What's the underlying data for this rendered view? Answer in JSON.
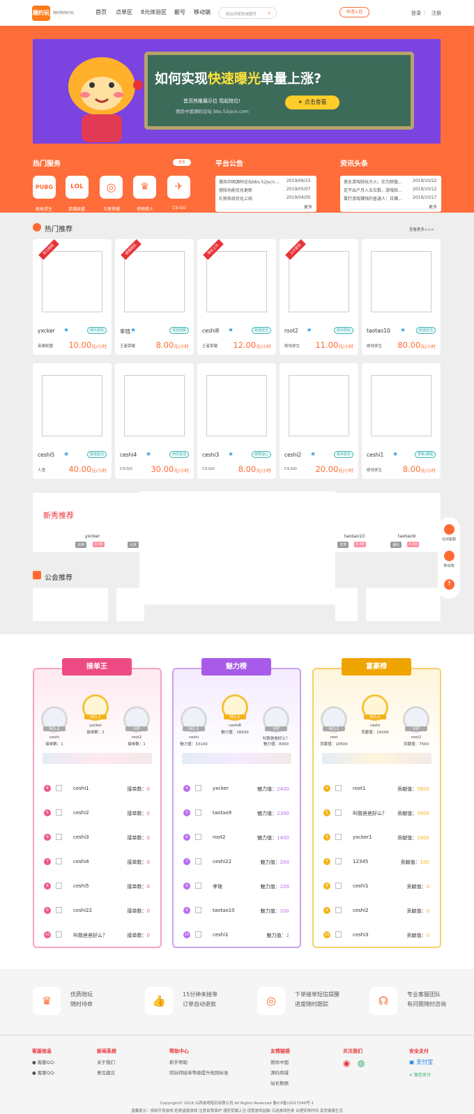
{
  "header": {
    "logo": "趣约玩",
    "slogan": "随时随地约玩",
    "nav": [
      "首页",
      "点单区",
      "8元体验区",
      "靓号",
      "移动端"
    ],
    "search_placeholder": "陪玩师昵称或靓号",
    "apply": "申请入驻",
    "login": "登录",
    "register": "注册"
  },
  "banner": {
    "title_a": "如何实现",
    "title_b": "快速曝光",
    "title_c": "单量上涨?",
    "sub": "首页热推展示位 现起抢位!",
    "sub2": "德尚中国源码论坛 bbs.52jscn.com",
    "btn": "点击查看"
  },
  "services": {
    "title": "热门服务",
    "more": "更多",
    "items": [
      {
        "icon": "PUBG",
        "label": "绝地求生"
      },
      {
        "icon": "LOL",
        "label": "英雄联盟"
      },
      {
        "icon": "◎",
        "label": "王者荣耀"
      },
      {
        "icon": "♛",
        "label": "怪物猎人"
      },
      {
        "icon": "✈",
        "label": "CS:GO"
      }
    ]
  },
  "notice": {
    "title": "平台公告",
    "rows": [
      {
        "t": "德尚中国源码论坛bbs.52jscn....",
        "d": "2019/06/15"
      },
      {
        "t": "搭陪功能优化更新",
        "d": "2019/05/07"
      },
      {
        "t": "礼物系统优化上线",
        "d": "2019/04/05"
      }
    ],
    "more": "更多"
  },
  "news": {
    "title": "资讯头条",
    "rows": [
      {
        "t": "美女游戏陪玩大火，实力颜值...",
        "d": "2019/10/22"
      },
      {
        "t": "足不出户月入五位数，游戏陪...",
        "d": "2019/10/12"
      },
      {
        "t": "靠打游戏赚钱的普通人：日赚...",
        "d": "2019/10/17"
      }
    ],
    "more": "更多"
  },
  "hot": {
    "title": "热门推荐",
    "more": "查看更多>>>",
    "cards": [
      {
        "rib": "实力陪练",
        "name": "yxcker",
        "tag": "娱乐陪玩",
        "game": "英雄联盟",
        "price": "10.00",
        "unit": "元/小时"
      },
      {
        "rib": "颜值陪玩",
        "name": "李琉",
        "tag": "语音陪聊",
        "game": "王者荣耀",
        "price": "8.00",
        "unit": "元/小时"
      },
      {
        "rib": "带你上分",
        "name": "ceshi8",
        "tag": "颜值担当",
        "game": "王者荣耀",
        "price": "12.00",
        "unit": "元/小时"
      },
      {
        "rib": "上分首选",
        "name": "root2",
        "tag": "技术陪玩",
        "game": "绝地求生",
        "price": "11.00",
        "unit": "元/小时"
      },
      {
        "rib": "",
        "name": "taotao10",
        "tag": "颜值担当",
        "game": "绝地求生",
        "price": "80.00",
        "unit": "元/小时"
      },
      {
        "rib": "",
        "name": "ceshi5",
        "tag": "颜值担当",
        "game": "人渣",
        "price": "40.00",
        "unit": "元/小时"
      },
      {
        "rib": "",
        "name": "ceshi4",
        "tag": "声优担当",
        "game": "CS:GO",
        "price": "30.00",
        "unit": "元/小时"
      },
      {
        "rib": "",
        "name": "ceshi3",
        "tag": "搞笑担心",
        "game": "CS:GO",
        "price": "8.00",
        "unit": "元/小时"
      },
      {
        "rib": "",
        "name": "ceshi2",
        "tag": "技术能手",
        "game": "CS:GO",
        "price": "20.00",
        "unit": "元/小时"
      },
      {
        "rib": "",
        "name": "ceshi1",
        "tag": "萝莉,御姐",
        "game": "绝地求生",
        "price": "8.00",
        "unit": "元/小时"
      }
    ]
  },
  "newcomer": {
    "title": "新秀推荐",
    "items": [
      {
        "name": "yxcker",
        "city": "云西",
        "age": "0.49"
      },
      {
        "name": "taotao10",
        "city": "甘肃",
        "age": "0.48"
      },
      {
        "name": "taotao9",
        "city": "湖北",
        "age": "0.49"
      }
    ],
    "city2": "北京"
  },
  "guild": {
    "title": "公会推荐"
  },
  "float": {
    "service": "在线客服",
    "mobile": "移动端"
  },
  "ranks": [
    {
      "title": "接单王",
      "top": [
        {
          "n": "ceshi",
          "v": "接单数：1",
          "b": "NO.2"
        },
        {
          "n": "yxcker",
          "v": "接单数：2",
          "b": "NO.1"
        },
        {
          "n": "root2",
          "v": "接单数：1",
          "b": "VIP"
        }
      ],
      "rows": [
        {
          "r": "4",
          "n": "ceshi1",
          "v": "接单数：",
          "x": "0"
        },
        {
          "r": "5",
          "n": "ceshi2",
          "v": "接单数：",
          "x": "0"
        },
        {
          "r": "6",
          "n": "ceshi3",
          "v": "接单数：",
          "x": "0"
        },
        {
          "r": "7",
          "n": "ceshi4",
          "v": "接单数：",
          "x": "0"
        },
        {
          "r": "8",
          "n": "ceshi5",
          "v": "接单数：",
          "x": "0"
        },
        {
          "r": "9",
          "n": "ceshi22",
          "v": "接单数：",
          "x": "0"
        },
        {
          "r": "10",
          "n": "叫我爸爸好么？",
          "v": "接单数：",
          "x": "0"
        }
      ]
    },
    {
      "title": "魅力榜",
      "top": [
        {
          "n": "ceshi",
          "v": "魅力值：33100",
          "b": "NO.2"
        },
        {
          "n": "ceshi8",
          "v": "魅力值：18200",
          "b": "NO.1"
        },
        {
          "n": "叫我爸爸好么？",
          "v": "魅力值：8000",
          "b": "VIP"
        }
      ],
      "rows": [
        {
          "r": "4",
          "n": "yxcker",
          "v": "魅力值：",
          "x": "2400"
        },
        {
          "r": "5",
          "n": "taotao9",
          "v": "魅力值：",
          "x": "2300"
        },
        {
          "r": "6",
          "n": "root2",
          "v": "魅力值：",
          "x": "1400"
        },
        {
          "r": "7",
          "n": "ceshi22",
          "v": "魅力值：",
          "x": "200"
        },
        {
          "r": "8",
          "n": "李琉",
          "v": "魅力值：",
          "x": "200"
        },
        {
          "r": "9",
          "n": "taotao10",
          "v": "魅力值：",
          "x": "100"
        },
        {
          "r": "10",
          "n": "ceshi1",
          "v": "魅力值：",
          "x": "2"
        }
      ]
    },
    {
      "title": "富豪榜",
      "top": [
        {
          "n": "root",
          "v": "贡献值：10500",
          "b": "NO.2"
        },
        {
          "n": "ceshi",
          "v": "贡献值：19100",
          "b": "NO.1"
        },
        {
          "n": "root2",
          "v": "贡献值：7500",
          "b": "VIP"
        }
      ],
      "rows": [
        {
          "r": "4",
          "n": "root1",
          "v": "贡献值：",
          "x": "5600"
        },
        {
          "r": "5",
          "n": "叫我爸爸好么？",
          "v": "贡献值：",
          "x": "3900"
        },
        {
          "r": "6",
          "n": "yxcker1",
          "v": "贡献值：",
          "x": "1800"
        },
        {
          "r": "7",
          "n": "12345",
          "v": "贡献值：",
          "x": "100"
        },
        {
          "r": "8",
          "n": "ceshi1",
          "v": "贡献值：",
          "x": "0"
        },
        {
          "r": "9",
          "n": "ceshi2",
          "v": "贡献值：",
          "x": "0"
        },
        {
          "r": "10",
          "n": "ceshi3",
          "v": "贡献值：",
          "x": "0"
        }
      ]
    }
  ],
  "features": [
    {
      "l1": "优质陪玩",
      "l2": "随时待命"
    },
    {
      "l1": "15分钟未接单",
      "l2": "订单自动退款"
    },
    {
      "l1": "下单接单短信提醒",
      "l2": "进度随时跟踪"
    },
    {
      "l1": "专业客服团队",
      "l2": "有问题随时咨询"
    }
  ],
  "footer": {
    "cols": [
      {
        "h": "客服信息",
        "items": [
          "客服QQ:",
          "客服QQ:"
        ]
      },
      {
        "h": "新闻系统",
        "items": [
          "关于我们",
          "意见建议"
        ]
      },
      {
        "h": "帮助中心",
        "items": [
          "新手帮助",
          "陪玩师接单等级提升规则标准"
        ]
      },
      {
        "h": "友情链接",
        "items": [
          "德尚中国",
          "源码商城",
          "站长数据"
        ]
      },
      {
        "h": "关注我们",
        "items": []
      },
      {
        "h": "安全支付",
        "items": [
          "支付宝",
          "微信支付"
        ]
      }
    ],
    "copyright": "Copyright© 2018 山西游戏陪玩有限公司 All Rights Reserved 鲁ICP备12017249号-1",
    "tip": "温馨提示：抵制不良游戏 拒绝盗版游戏 注意自我保护 谨防受骗上当 适度游戏益脑 沉迷游戏伤身 合理安排时间 享受健康生活"
  }
}
